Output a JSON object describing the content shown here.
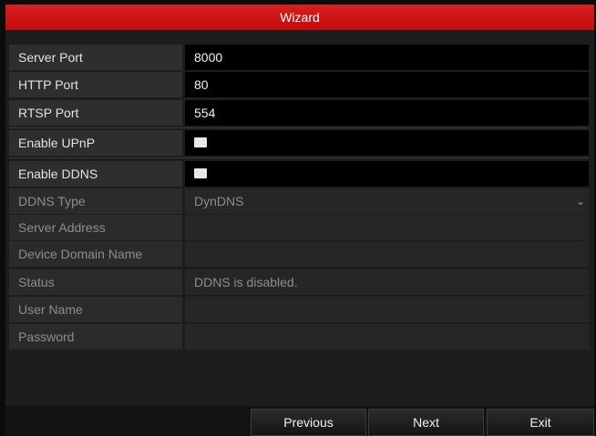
{
  "window": {
    "title": "Wizard"
  },
  "form": {
    "server_port": {
      "label": "Server Port",
      "value": "8000"
    },
    "http_port": {
      "label": "HTTP Port",
      "value": "80"
    },
    "rtsp_port": {
      "label": "RTSP Port",
      "value": "554"
    },
    "enable_upnp": {
      "label": "Enable UPnP",
      "checked": false
    },
    "enable_ddns": {
      "label": "Enable DDNS",
      "checked": false
    },
    "ddns_type": {
      "label": "DDNS Type",
      "value": "DynDNS"
    },
    "server_address": {
      "label": "Server Address",
      "value": ""
    },
    "device_domain_name": {
      "label": "Device Domain Name",
      "value": ""
    },
    "status": {
      "label": "Status",
      "value": "DDNS is disabled."
    },
    "user_name": {
      "label": "User Name",
      "value": ""
    },
    "password": {
      "label": "Password",
      "value": ""
    }
  },
  "buttons": {
    "previous": "Previous",
    "next": "Next",
    "exit": "Exit"
  },
  "icons": {
    "checkbox": "checkbox-icon",
    "dropdown": "chevron-down-icon"
  },
  "colors": {
    "title_bar": "#c20b0b",
    "background": "#1d1d1d"
  }
}
